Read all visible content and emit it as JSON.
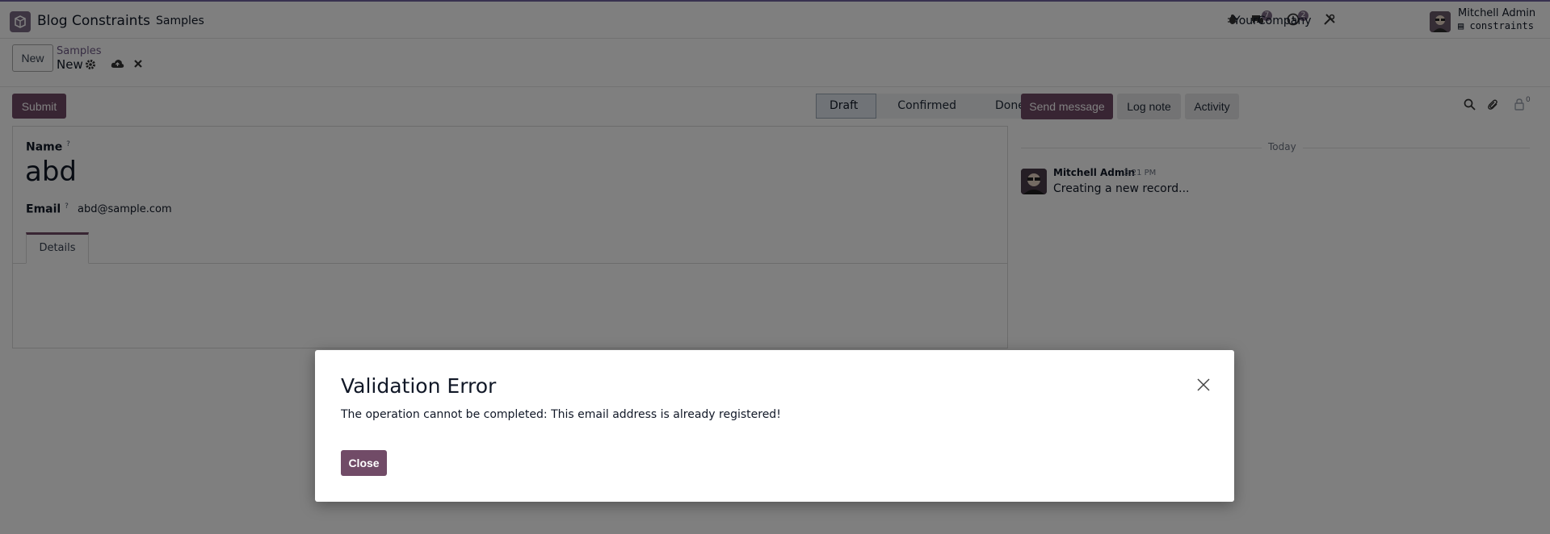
{
  "navbar": {
    "app_name": "Blog Constraints",
    "menu_samples": "Samples",
    "messages_count": "7",
    "activities_count": "2",
    "company": "YourCompany",
    "user_name": "Mitchell Admin",
    "database": "constraints"
  },
  "control": {
    "new_label": "New",
    "breadcrumb_parent": "Samples",
    "breadcrumb_current": "New"
  },
  "form": {
    "submit_label": "Submit",
    "stages": [
      "Draft",
      "Confirmed",
      "Done"
    ],
    "active_stage": "Draft",
    "name_label": "Name",
    "name_help": "?",
    "name_value": "abd",
    "email_label": "Email",
    "email_help": "?",
    "email_value": "abd@sample.com",
    "tab_details": "Details"
  },
  "chatter": {
    "send_message": "Send message",
    "log_note": "Log note",
    "activity": "Activity",
    "followers_count": "0",
    "date_separator": "Today",
    "messages": [
      {
        "author": "Mitchell Admin",
        "time": "3:21 PM",
        "body": "Creating a new record..."
      }
    ]
  },
  "dialog": {
    "title": "Validation Error",
    "message": "The operation cannot be completed: This email address is already registered!",
    "close_label": "Close"
  },
  "colors": {
    "primary": "#714b67",
    "overlay": "rgba(0,0,0,0.5)"
  }
}
